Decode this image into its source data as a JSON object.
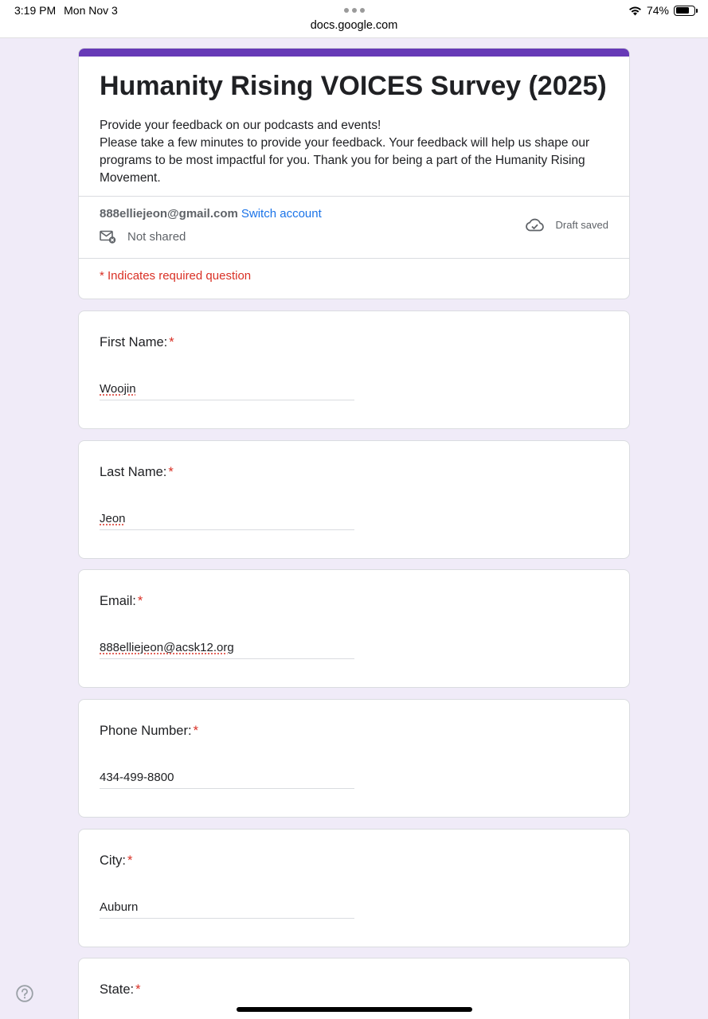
{
  "status_bar": {
    "time": "3:19 PM",
    "date": "Mon Nov 3",
    "battery": "74%",
    "battery_level": 0.74,
    "icons": [
      "wifi-icon",
      "battery-icon"
    ]
  },
  "browser": {
    "url": "docs.google.com"
  },
  "form": {
    "accent_color": "#673ab7",
    "title": "Humanity Rising VOICES Survey (2025)",
    "description_line1": "Provide your feedback on our podcasts and events!",
    "description_line2": "Please take a few minutes to provide your feedback. Your feedback will help us shape our programs to be most impactful for you. Thank you for being a part of the Humanity Rising Movement.",
    "account_email": "888elliejeon@gmail.com",
    "switch_account": "Switch account",
    "not_shared": "Not shared",
    "draft_status": "Draft saved",
    "required_note": "* Indicates required question",
    "required_color": "#d93025",
    "link_color": "#1a73e8"
  },
  "questions": [
    {
      "label": "First Name:",
      "required": "*",
      "value": "Woojin"
    },
    {
      "label": "Last Name:",
      "required": "*",
      "value": "Jeon"
    },
    {
      "label": "Email:",
      "required": "*",
      "value": "888elliejeon@acsk12.org"
    },
    {
      "label": "Phone Number:",
      "required": "*",
      "value": "434-499-8800"
    },
    {
      "label": "City:",
      "required": "*",
      "value": "Auburn"
    },
    {
      "label": "State:",
      "required": "*",
      "value": ""
    }
  ]
}
